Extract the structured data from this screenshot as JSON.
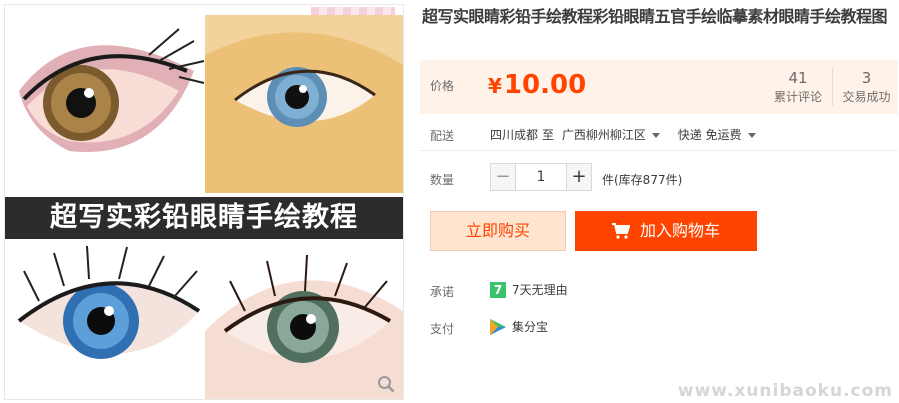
{
  "product": {
    "title": "超写实眼睛彩铅手绘教程彩铅眼睛五官手绘临摹素材眼睛手绘教程图",
    "image_banner": "超写实彩铅眼睛手绘教程"
  },
  "price": {
    "label": "价格",
    "currency": "¥",
    "value": "10.00",
    "reviews_count": "41",
    "reviews_label": "累计评论",
    "deals_count": "3",
    "deals_label": "交易成功"
  },
  "shipping": {
    "label": "配送",
    "from": "四川成都",
    "to_word": "至",
    "destination": "广西柳州柳江区",
    "method": "快递 免运费"
  },
  "quantity": {
    "label": "数量",
    "minus": "−",
    "value": "1",
    "plus": "+",
    "stock": "件(库存877件)"
  },
  "actions": {
    "buy_now": "立即购买",
    "add_to_cart": "加入购物车"
  },
  "promise": {
    "label": "承诺",
    "icon_text": "7",
    "text": "7天无理由"
  },
  "payment": {
    "label": "支付",
    "method": "集分宝"
  },
  "watermark": "www.xunibaoku.com",
  "colors": {
    "accent": "#ff4400",
    "price_bg": "#fff2e8",
    "buy_bg": "#ffe4d0",
    "promise_icon": "#3cc16d"
  },
  "icons": [
    "zoom-icon",
    "cart-icon",
    "seven-day-icon",
    "jifenbao-icon",
    "caret-down-icon"
  ]
}
